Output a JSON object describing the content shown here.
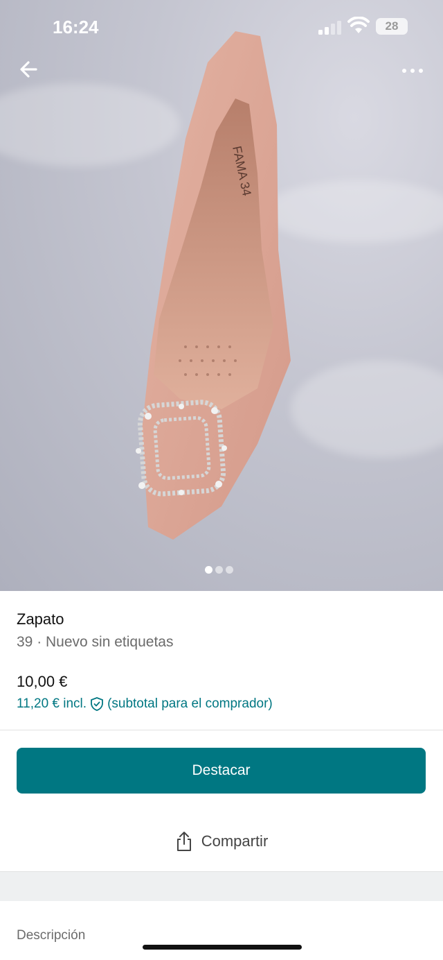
{
  "status_bar": {
    "time": "16:24",
    "battery": "28"
  },
  "gallery": {
    "image_alt": "Zapato de salón rosa con broche de strass",
    "image_count": 3,
    "active_index": 0
  },
  "product": {
    "title": "Zapato",
    "subtitle": "39 · Nuevo sin etiquetas",
    "price": "10,00 €",
    "price_incl": "11,20 € incl.",
    "price_incl_note": "(subtotal para el comprador)"
  },
  "actions": {
    "highlight_label": "Destacar",
    "share_label": "Compartir"
  },
  "description": {
    "label": "Descripción"
  },
  "colors": {
    "accent": "#007782",
    "text": "#111111",
    "muted": "#6b6b6b"
  },
  "icons": {
    "back": "back-arrow-icon",
    "more": "more-dots-icon",
    "shield": "shield-check-icon",
    "share": "share-icon"
  }
}
